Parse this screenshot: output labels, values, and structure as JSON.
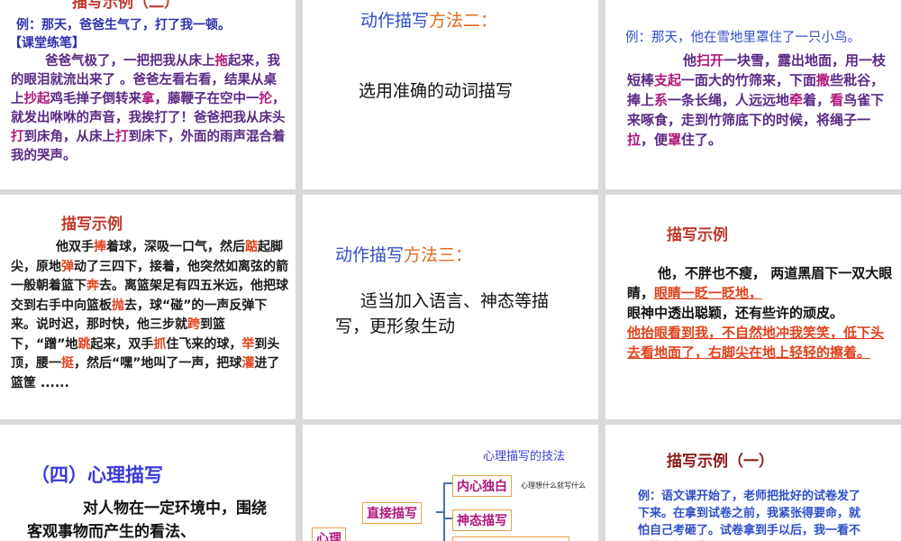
{
  "s1": {
    "title": "描写示例（二）",
    "example": "例：那天，爸爸生气了，打了我一顿。",
    "practice": "【课堂练笔】",
    "p": [
      {
        "t": "爸爸气极了，一把把我从床上",
        "c": ""
      },
      {
        "t": "拖",
        "c": "pink"
      },
      {
        "t": "起来，我的眼泪就流出来了 。爸爸左看右看，结果从桌上",
        "c": ""
      },
      {
        "t": "抄起",
        "c": "pink"
      },
      {
        "t": "鸡毛掸子倒转来",
        "c": ""
      },
      {
        "t": "拿",
        "c": "pink"
      },
      {
        "t": "，藤鞭子在空中一",
        "c": ""
      },
      {
        "t": "抡",
        "c": "pink"
      },
      {
        "t": "，就发出咻咻的声音，我挨打了！爸爸把我从床头",
        "c": ""
      },
      {
        "t": "打",
        "c": "pink"
      },
      {
        "t": "到床角，从床上",
        "c": ""
      },
      {
        "t": "打",
        "c": "pink"
      },
      {
        "t": "到床下，外面的雨声混合着我的哭声。",
        "c": ""
      }
    ]
  },
  "s2": {
    "title_a": "动作描写",
    "title_b": "方法二：",
    "body": "选用准确的动词描写"
  },
  "s3": {
    "example": "例：那天，他在雪地里罩住了一只小鸟。",
    "p": [
      {
        "t": "他",
        "c": ""
      },
      {
        "t": "扫开",
        "c": "pink"
      },
      {
        "t": "一块雪，露出地面，用一枝短棒",
        "c": ""
      },
      {
        "t": "支起",
        "c": "pink"
      },
      {
        "t": "一面大的竹筛来，下面",
        "c": ""
      },
      {
        "t": "撒",
        "c": "pink"
      },
      {
        "t": "些秕谷，捧上",
        "c": ""
      },
      {
        "t": "系",
        "c": "pink"
      },
      {
        "t": "一条长绳，人远远地",
        "c": ""
      },
      {
        "t": "牵",
        "c": "pink"
      },
      {
        "t": "着，",
        "c": ""
      },
      {
        "t": "看",
        "c": "pink"
      },
      {
        "t": "鸟雀下来啄食，走到竹筛底下的时候，将绳子一",
        "c": ""
      },
      {
        "t": "拉",
        "c": "pink"
      },
      {
        "t": "，便",
        "c": ""
      },
      {
        "t": "罩",
        "c": "pink"
      },
      {
        "t": "住了。",
        "c": ""
      }
    ]
  },
  "s4": {
    "title": "描写示例",
    "p": [
      {
        "t": "他双手",
        "c": ""
      },
      {
        "t": "捧",
        "c": "red"
      },
      {
        "t": "着球，深吸一口气，然后",
        "c": ""
      },
      {
        "t": "踮",
        "c": "red"
      },
      {
        "t": "起脚尖，原地",
        "c": ""
      },
      {
        "t": "弹",
        "c": "red"
      },
      {
        "t": "动了三四下，接着，他突然如离弦的箭一般朝着篮下",
        "c": ""
      },
      {
        "t": "奔",
        "c": "red"
      },
      {
        "t": "去。离篮架足有四五米远，他把球交到右手中向篮板",
        "c": ""
      },
      {
        "t": "抛",
        "c": "red"
      },
      {
        "t": "去，球“碰”的一声反弹下来。说时迟，那时快，他三步就",
        "c": ""
      },
      {
        "t": "跨",
        "c": "red"
      },
      {
        "t": "到篮下，“蹭”地",
        "c": ""
      },
      {
        "t": "跳",
        "c": "red"
      },
      {
        "t": "起来，双手",
        "c": ""
      },
      {
        "t": "抓",
        "c": "red"
      },
      {
        "t": "住飞来的球，",
        "c": ""
      },
      {
        "t": "举",
        "c": "red"
      },
      {
        "t": "到头顶，腰一",
        "c": ""
      },
      {
        "t": "挺",
        "c": "red"
      },
      {
        "t": "，然后“嘿”地叫了一声，把球",
        "c": ""
      },
      {
        "t": "灌",
        "c": "red"
      },
      {
        "t": "进了篮筐 ......",
        "c": ""
      }
    ]
  },
  "s5": {
    "title_a": "动作描写",
    "title_b": "方法三：",
    "body": "适当加入语言、神态等描写，更形象生动"
  },
  "s6": {
    "title": "描写示例",
    "line1": "他，不胖也不瘦， 两道黑眉下一双大眼睛，",
    "line1_red": "眼睛一眨一眨地，",
    "line2": "眼神中透出聪颖，还有些许的顽皮。",
    "line3_red": "他抬眼看到我，不自然地冲我笑笑，低下头去看地面了，右脚尖在地上轻轻的擦着。"
  },
  "s7": {
    "title": "（四）心理描写",
    "body": "对人物在一定环境中，围绕客观事物而产生的看法、"
  },
  "s8": {
    "caption": "心理描写的技法",
    "root": "心理",
    "direct": "直接描写",
    "inner": "内心独白",
    "inner_note": "心理想什么就写什么",
    "expr": "神态描写"
  },
  "s9": {
    "title": "描写示例（一）",
    "body": "例：语文课开始了，老师把批好的试卷发了下来。在拿到试卷之前，我紧张得要命，就怕自己考砸了。试卷拿到手以后，我一看不及格，很是伤心。"
  }
}
